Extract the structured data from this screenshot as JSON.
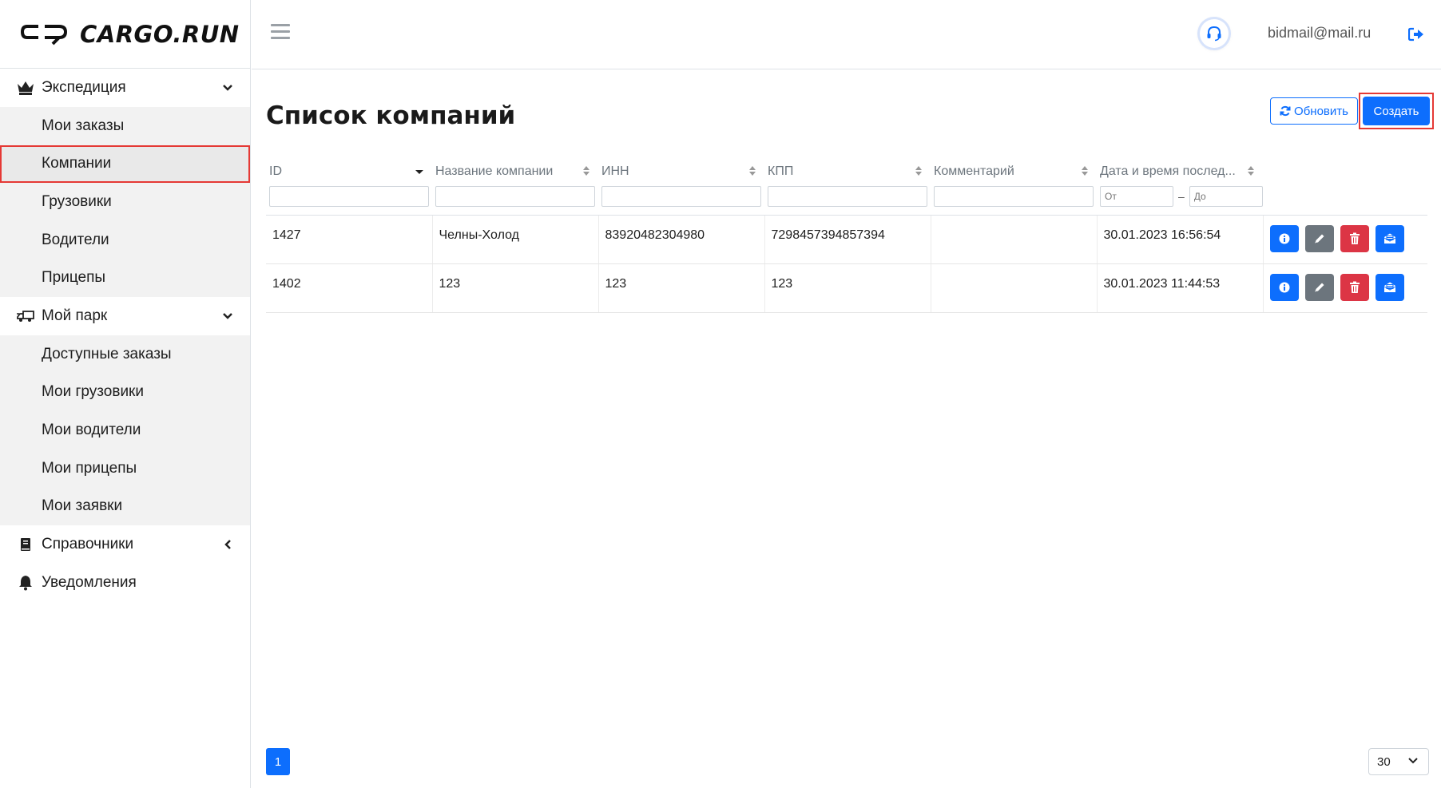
{
  "app": {
    "logo_text": "CARGO.RUN"
  },
  "header": {
    "user_email": "bidmail@mail.ru"
  },
  "sidebar": {
    "groups": [
      {
        "label": "Экспедиция",
        "icon": "crown-icon",
        "items": [
          "Мои заказы",
          "Компании",
          "Грузовики",
          "Водители",
          "Прицепы"
        ]
      },
      {
        "label": "Мой парк",
        "icon": "truck-icon",
        "items": [
          "Доступные заказы",
          "Мои грузовики",
          "Мои водители",
          "Мои прицепы",
          "Мои заявки"
        ]
      },
      {
        "label": "Справочники",
        "icon": "book-icon",
        "items": []
      },
      {
        "label": "Уведомления",
        "icon": "bell-icon",
        "items": []
      }
    ],
    "active_item": "Компании"
  },
  "page": {
    "title": "Список компаний",
    "refresh_label": "Обновить",
    "create_label": "Создать"
  },
  "table": {
    "columns": [
      "ID",
      "Название компании",
      "ИНН",
      "КПП",
      "Комментарий",
      "Дата и время послед..."
    ],
    "date_filter": {
      "from_placeholder": "От",
      "to_placeholder": "До"
    },
    "rows": [
      {
        "id": "1427",
        "name": "Челны-Холод",
        "inn": "83920482304980",
        "kpp": "7298457394857394",
        "comment": "",
        "datetime": "30.01.2023 16:56:54"
      },
      {
        "id": "1402",
        "name": "123",
        "inn": "123",
        "kpp": "123",
        "comment": "",
        "datetime": "30.01.2023 11:44:53"
      }
    ]
  },
  "pagination": {
    "current_page": "1",
    "per_page": "30"
  },
  "colors": {
    "primary": "#0d6efd",
    "danger": "#dc3545",
    "secondary": "#6c757d",
    "highlight": "#e53935"
  }
}
